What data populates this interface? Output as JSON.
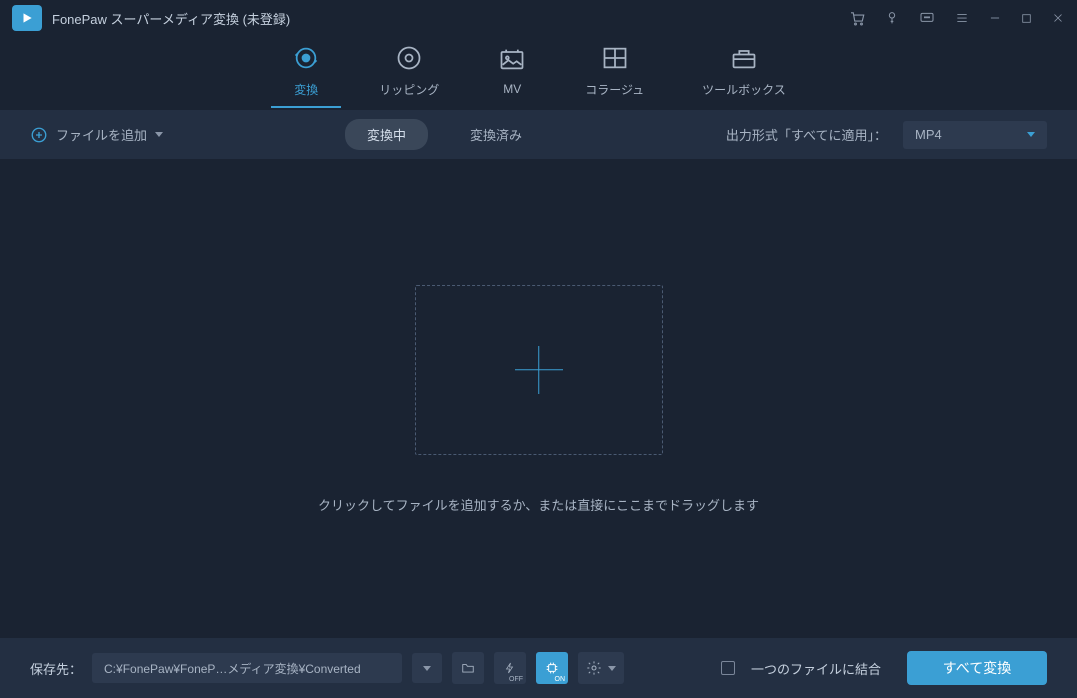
{
  "title": "FonePaw スーパーメディア変換 (未登録)",
  "navtabs": {
    "convert": "変換",
    "ripping": "リッピング",
    "mv": "MV",
    "collage": "コラージュ",
    "toolbox": "ツールボックス"
  },
  "toolbar": {
    "add_file": "ファイルを追加",
    "converting": "変換中",
    "converted": "変換済み",
    "output_format_label": "出力形式「すべてに適用」：",
    "output_format_value": "MP4"
  },
  "dropzone_hint": "クリックしてファイルを追加するか、または直接にここまでドラッグします",
  "bottombar": {
    "save_to_label": "保存先：",
    "save_path": "C:¥FonePaw¥FoneP…メディア変換¥Converted",
    "lightning_sub": "OFF",
    "gpu_sub": "ON",
    "merge_label": "一つのファイルに結合",
    "convert_all": "すべて変換"
  }
}
